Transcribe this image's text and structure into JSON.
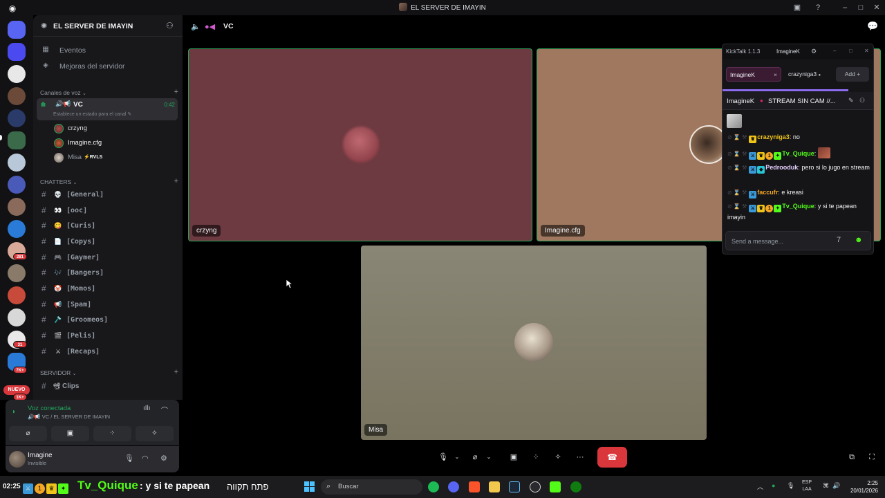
{
  "window": {
    "title": "EL SERVER DE IMAYIN"
  },
  "server": {
    "name": "EL SERVER DE IMAYIN",
    "top_items": [
      {
        "icon": "calendar-icon",
        "label": "Eventos"
      },
      {
        "icon": "boost-icon",
        "label": "Mejoras del servidor"
      }
    ],
    "voice_category": "Canales de voz",
    "voice_channel": {
      "emoji": "🔊📢",
      "name": "VC",
      "timer": "0:42",
      "status_placeholder": "Establece un estado para el canal"
    },
    "voice_members": [
      {
        "name": "crzyng",
        "tag": ""
      },
      {
        "name": "Imagine.cfg",
        "tag": ""
      },
      {
        "name": "Misa",
        "tag": "⚡RVLS"
      }
    ],
    "text_category": "CHATTERS",
    "text_channels": [
      {
        "emoji": "💀",
        "name": "[General]"
      },
      {
        "emoji": "👀",
        "name": "[ooc]"
      },
      {
        "emoji": "😋",
        "name": "[Curis]"
      },
      {
        "emoji": "📄",
        "name": "[Copys]"
      },
      {
        "emoji": "🎮",
        "name": "[Gaymer]"
      },
      {
        "emoji": "🎶",
        "name": "[Bangers]"
      },
      {
        "emoji": "🤡",
        "name": "[Momos]"
      },
      {
        "emoji": "📢",
        "name": "[Spam]"
      },
      {
        "emoji": "🪒",
        "name": "[Groomeos]"
      },
      {
        "emoji": "🎬",
        "name": "[Pelis]"
      },
      {
        "emoji": "⚔",
        "name": "[Recaps]"
      }
    ],
    "server_category": "SERVIDOR",
    "server_channels": [
      {
        "emoji": "📽",
        "name": "Clips"
      }
    ]
  },
  "rail": {
    "badges": [
      "281",
      "31",
      "7K+",
      "1K+"
    ],
    "new_label": "NUEVO"
  },
  "voice_panel": {
    "title": "Voz conectada",
    "subtitle": "🔊📢 VC / EL SERVER DE IMAYIN"
  },
  "user_panel": {
    "name": "Imagine",
    "status": "Invisible"
  },
  "stage": {
    "channel_name": "VC",
    "tiles": [
      {
        "label": "crzyng"
      },
      {
        "label": "Imagine.cfg"
      },
      {
        "label": "Misa"
      }
    ]
  },
  "kicktalk": {
    "app_name": "KickTalk 1.1.3",
    "user": "ImagineK",
    "tabs": [
      {
        "label": "ImagineK",
        "active": true
      },
      {
        "label": "crazyniga3",
        "active": false
      }
    ],
    "add_label": "Add",
    "channel": "ImagineK",
    "stream_title": "STREAM SIN CAM //...",
    "messages": [
      {
        "user": "crazyniga3",
        "text": "no",
        "user_color": "#f0c419"
      },
      {
        "user": "Tv_Quique",
        "text": "",
        "user_color": "#53fc18"
      },
      {
        "user": "Pedrooduk",
        "text": "pero si lo jugo en stream",
        "user_color": "#e8d0ff"
      },
      {
        "user": "faccufr",
        "text": "e kreasi",
        "user_color": "#f5a623"
      },
      {
        "user": "Tv_Quique",
        "text": "y si te papean imayin",
        "user_color": "#53fc18"
      }
    ],
    "input_placeholder": "Send a message..."
  },
  "ticker": {
    "time": "02:25",
    "user": "Tv_Quique",
    "message": ": y si te papean",
    "extra": "פתח תקווה"
  },
  "taskbar": {
    "search_placeholder": "Buscar",
    "lang": "ESP",
    "lang_sub": "LAA",
    "time": "2:25",
    "date": "20/01/2026"
  }
}
